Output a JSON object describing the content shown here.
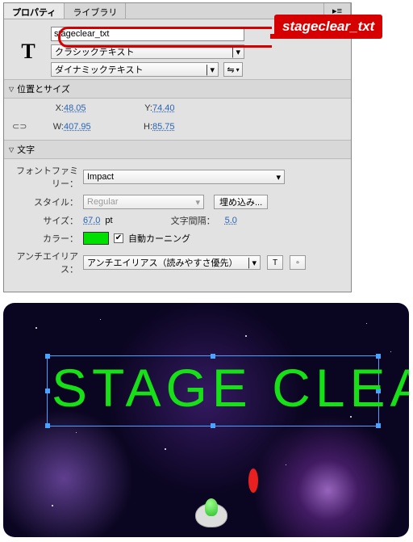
{
  "panel": {
    "tabs": {
      "properties": "プロパティ",
      "library": "ライブラリ"
    },
    "instance_name": "stageclear_txt",
    "text_engine": "クラシックテキスト",
    "text_type": "ダイナミックテキスト"
  },
  "sections": {
    "position_size": {
      "title": "位置とサイズ",
      "x_label": "X:",
      "x": "48.05",
      "y_label": "Y:",
      "74.40": "74.40",
      "y": "74.40",
      "w_label": "W:",
      "w": "407.95",
      "h_label": "H:",
      "h": "85.75"
    },
    "character": {
      "title": "文字",
      "family_label": "フォントファミリー：",
      "family": "Impact",
      "style_label": "スタイル：",
      "style": "Regular",
      "embed_btn": "埋め込み...",
      "size_label": "サイズ：",
      "size": "67.0",
      "size_unit": "pt",
      "spacing_label": "文字間隔：",
      "spacing": "5.0",
      "color_label": "カラー：",
      "auto_kern": "自動カーニング",
      "aa_label": "アンチエイリアス：",
      "aa": "アンチエイリアス（読みやすさ優先）"
    }
  },
  "callout": {
    "label": "stageclear_txt"
  },
  "stage": {
    "text": "STAGE CLEAR"
  },
  "colors": {
    "accent_red": "#d60000",
    "stage_text": "#16e016",
    "swatch": "#00e000"
  }
}
